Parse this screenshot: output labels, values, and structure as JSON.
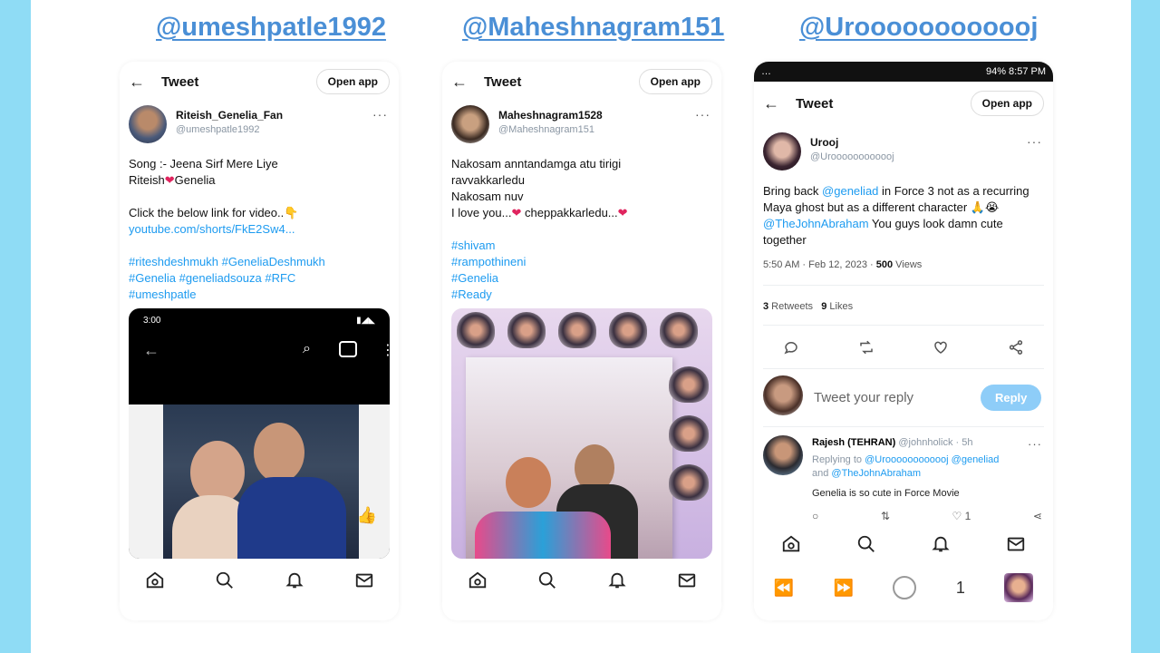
{
  "panels": [
    {
      "handle": "@umeshpatle1992",
      "header": {
        "title": "Tweet",
        "open_app": "Open app"
      },
      "author": {
        "name": "Riteish_Genelia_Fan",
        "handle": "@umeshpatle1992"
      },
      "text": {
        "line1": "Song :- Jeena Sirf Mere Liye",
        "line2a": "Riteish",
        "line2b": "Genelia",
        "line3": "Click the below link for video..",
        "link": "youtube.com/shorts/FkE2Sw4...",
        "hashtags1": "#riteshdeshmukh #GeneliaDeshmukh",
        "hashtags2": "#Genelia #geneliadsouza #RFC",
        "hashtags3": "#umeshpatle"
      },
      "media_status": "3:00"
    },
    {
      "handle": "@Maheshnagram151",
      "header": {
        "title": "Tweet",
        "open_app": "Open app"
      },
      "author": {
        "name": "Maheshnagram1528",
        "handle": "@Maheshnagram151"
      },
      "text": {
        "line1": "Nakosam anntandamga atu tirigi",
        "line2": "ravvakkarledu",
        "line3": "Nakosam nuv",
        "line4a": "I love you...",
        "line4b": "cheppakkarledu...",
        "tag1": "#shivam",
        "tag2": "#rampothineni",
        "tag3": "#Genelia",
        "tag4": "#Ready"
      }
    },
    {
      "handle": "@Uroooooooooooj",
      "status_bar": {
        "left": "…",
        "right": "94% 8:57 PM"
      },
      "header": {
        "title": "Tweet",
        "open_app": "Open app"
      },
      "author": {
        "name": "Urooj",
        "handle": "@Uroooooooooooj"
      },
      "text": {
        "p1": "Bring back ",
        "mention1": "@geneliad",
        "p2": " in Force 3 not as a recurring Maya ghost but as a different character",
        "emoji": " 🙏😭 ",
        "mention2": "@TheJohnAbraham",
        "p3": " You guys look damn cute together"
      },
      "meta": {
        "time": "5:50 AM · Feb 12, 2023 · ",
        "views_count": "500",
        "views_label": " Views"
      },
      "stats": {
        "retweets_count": "3",
        "retweets_label": " Retweets",
        "likes_count": "9",
        "likes_label": " Likes"
      },
      "reply_placeholder": "Tweet your reply",
      "reply_button": "Reply",
      "reply": {
        "name": "Rajesh (TEHRAN)",
        "handle": "@johnholick · 5h",
        "replying_to": "Replying to ",
        "replying_mentions": "@Uroooooooooooj @geneliad",
        "replying_and": "and ",
        "replying_mention2": "@TheJohnAbraham",
        "text": "Genelia is so cute in Force Movie",
        "like_count": "1"
      },
      "browser_bar": {
        "tab_count": "1"
      }
    }
  ],
  "colors": {
    "handle_blue": "#4a8fd6",
    "link_blue": "#1d9bf0",
    "heart_red": "#e0245e",
    "frame_cyan": "#8fdcf5"
  }
}
